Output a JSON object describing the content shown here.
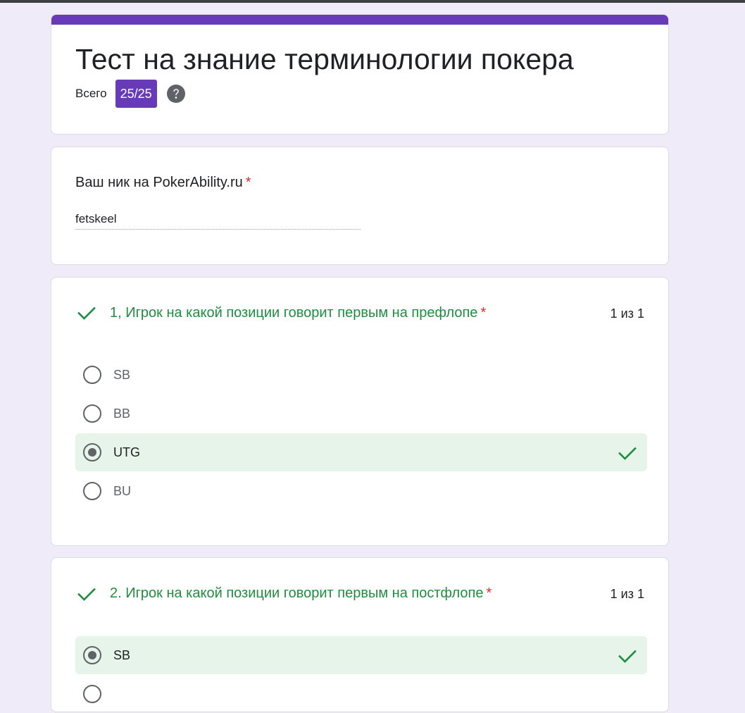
{
  "form": {
    "title": "Тест на знание терминологии покера",
    "total_label": "Всего",
    "score": "25/25",
    "help_icon": "help-circle-icon"
  },
  "nickname": {
    "label": "Ваш ник на PokerAbility.ru",
    "required_mark": "*",
    "value": "fetskeel"
  },
  "questions": [
    {
      "text": "1, Игрок на какой позиции говорит первым на префлопе",
      "required_mark": "*",
      "score": "1 из 1",
      "status_icon": "check-icon",
      "options": [
        {
          "label": "SB",
          "selected": false
        },
        {
          "label": "BB",
          "selected": false
        },
        {
          "label": "UTG",
          "selected": true,
          "correct": true
        },
        {
          "label": "BU",
          "selected": false
        }
      ]
    },
    {
      "text": "2. Игрок на какой позиции говорит первым на постфлопе",
      "required_mark": "*",
      "score": "1 из 1",
      "status_icon": "check-icon",
      "options": [
        {
          "label": "SB",
          "selected": true,
          "correct": true
        }
      ]
    }
  ],
  "colors": {
    "accent": "#673ab7",
    "correct": "#1e8e3e",
    "correct_bg": "#e6f4ea",
    "required": "#d93025",
    "page_bg": "#efebf8"
  }
}
